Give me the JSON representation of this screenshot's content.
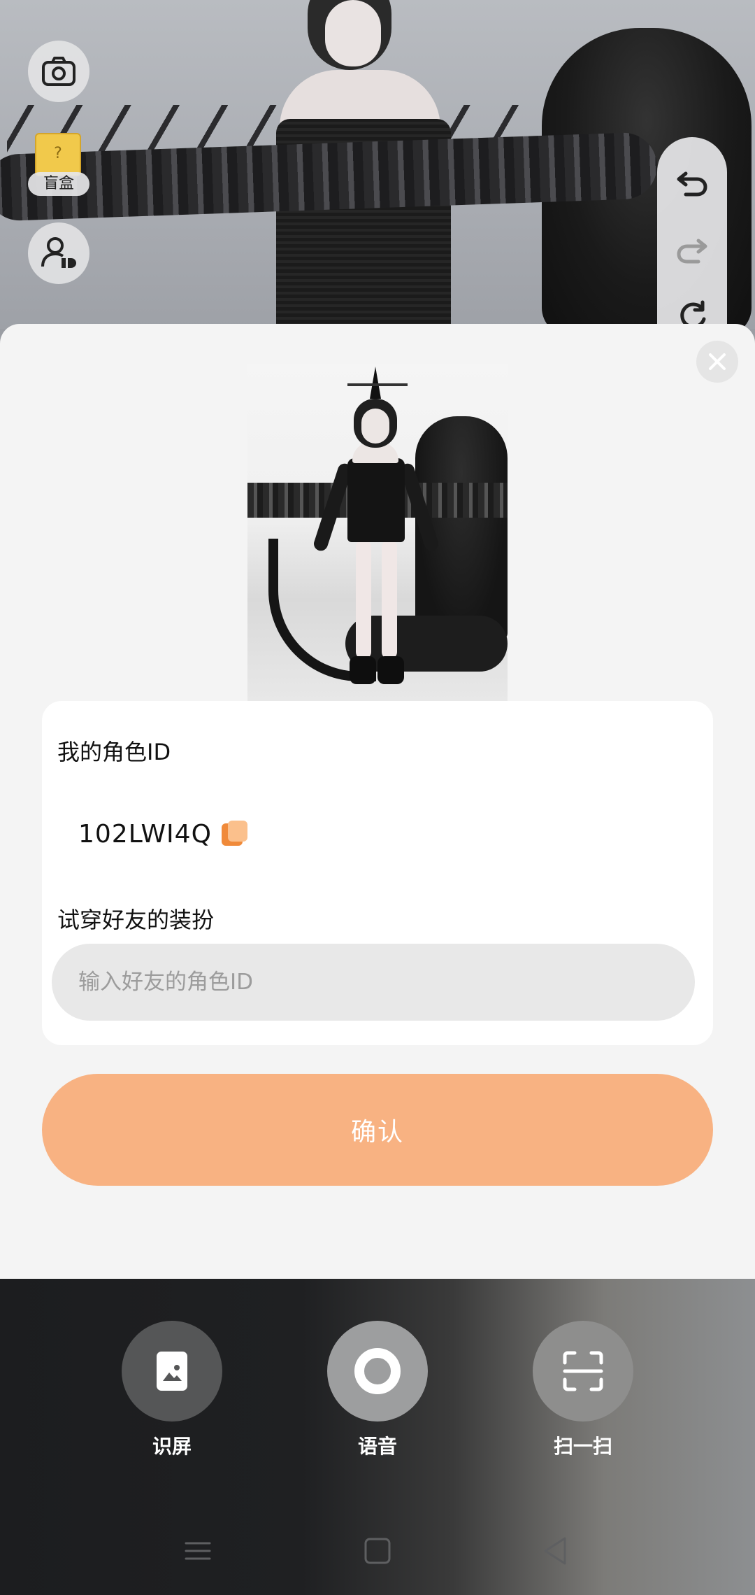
{
  "scene": {
    "blind_box_label": "盲盒"
  },
  "id_card": {
    "my_id_label": "我的角色ID",
    "my_id_value": "102LWI4Q",
    "try_on_label": "试穿好友的装扮",
    "friend_id_input": {
      "value": "",
      "placeholder": "输入好友的角色ID"
    }
  },
  "confirm_label": "确认",
  "bottom_tools": [
    {
      "label": "识屏",
      "icon": "screen-image-icon"
    },
    {
      "label": "语音",
      "icon": "record-icon"
    },
    {
      "label": "扫一扫",
      "icon": "scan-icon"
    }
  ],
  "colors": {
    "accent": "#f8b282",
    "copy_icon": "#f08a3a",
    "sheet_bg": "#f4f4f4",
    "input_bg": "#e8e8e8"
  }
}
